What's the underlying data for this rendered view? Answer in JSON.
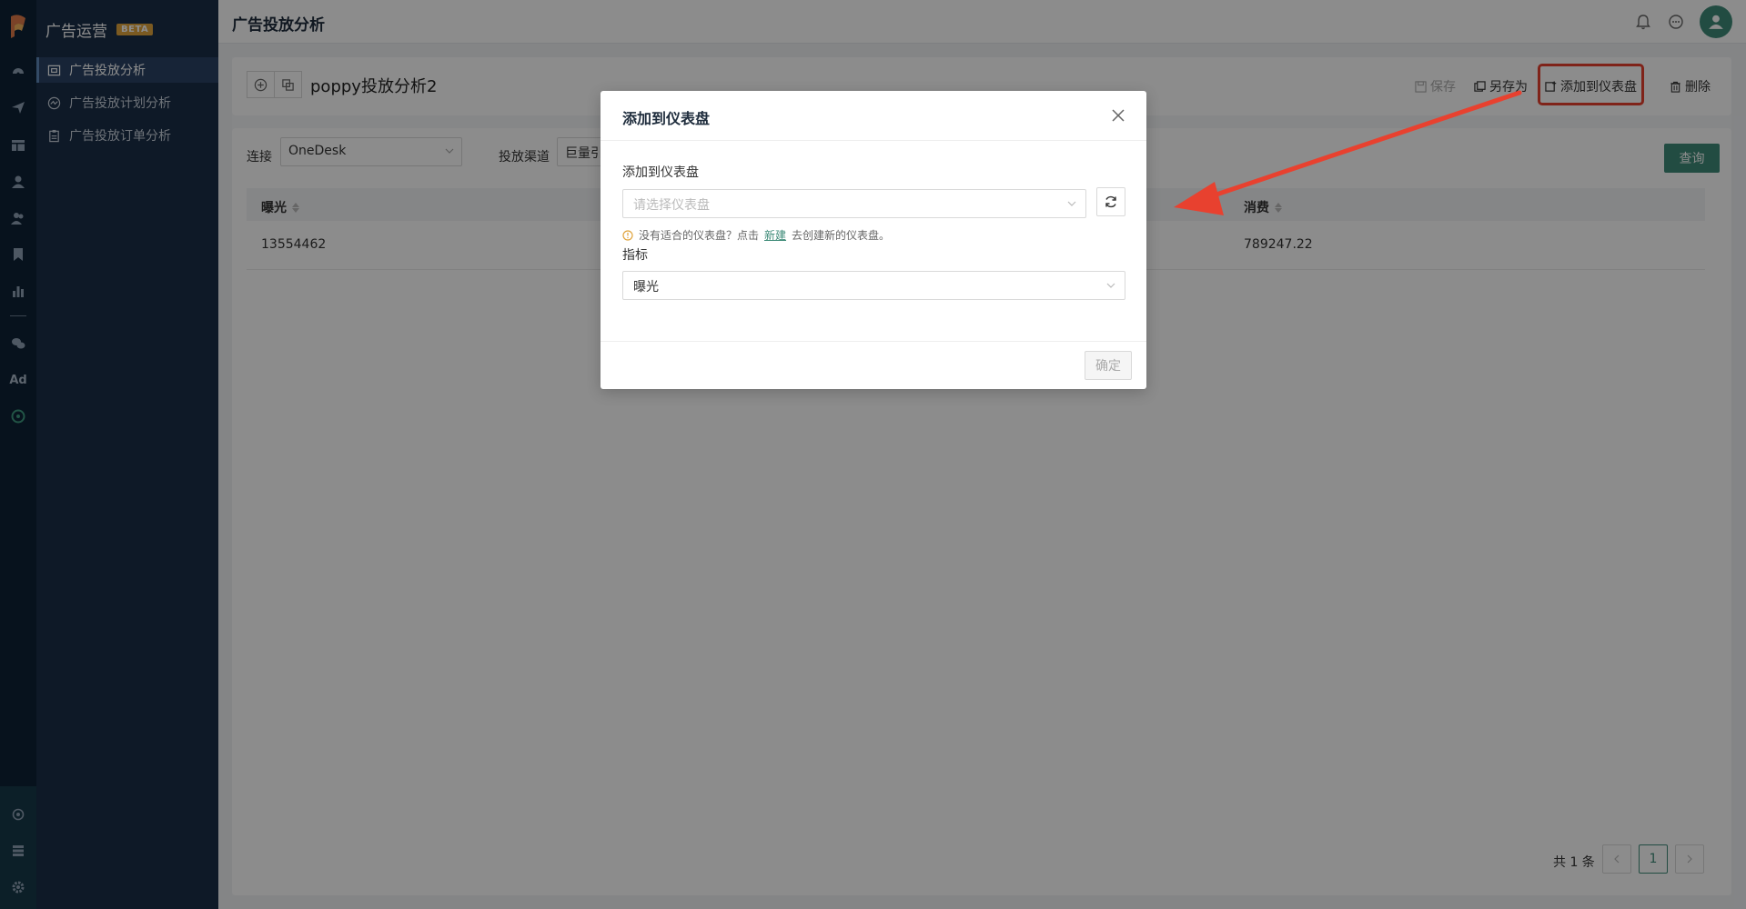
{
  "app": {
    "brand_title": "广告运营",
    "beta_badge": "BETA",
    "page_title": "广告投放分析"
  },
  "menu": {
    "items": [
      {
        "label": "广告投放分析",
        "icon": "report-icon",
        "active": true
      },
      {
        "label": "广告投放计划分析",
        "icon": "trend-icon",
        "active": false
      },
      {
        "label": "广告投放订单分析",
        "icon": "clipboard-icon",
        "active": false
      }
    ]
  },
  "rail": {
    "ad_label": "Ad"
  },
  "toolbar": {
    "report_title": "poppy投放分析2",
    "save_label": "保存",
    "save_as_label": "另存为",
    "add_dashboard_label": "添加到仪表盘",
    "delete_label": "删除"
  },
  "filters": {
    "connection_label": "连接",
    "connection_value": "OneDesk",
    "channel_label": "投放渠道",
    "channel_value": "巨量引",
    "query_label": "查询"
  },
  "table": {
    "columns": [
      "曝光",
      "消费"
    ],
    "rows": [
      [
        "13554462",
        "789247.22"
      ]
    ]
  },
  "pagination": {
    "total_text": "共 1 条",
    "current_page": "1"
  },
  "modal": {
    "title": "添加到仪表盘",
    "dashboard_label": "添加到仪表盘",
    "dashboard_placeholder": "请选择仪表盘",
    "hint_prefix": "没有适合的仪表盘？点击",
    "hint_link": "新建",
    "hint_suffix": "去创建新的仪表盘。",
    "metric_label": "指标",
    "metric_value": "曝光",
    "ok_label": "确定"
  },
  "colors": {
    "accent": "#3e8b78",
    "rail_bg": "#0d2236",
    "menu_bg": "#1b2e47",
    "highlight": "#e8412f",
    "beta": "#e0a43d"
  }
}
